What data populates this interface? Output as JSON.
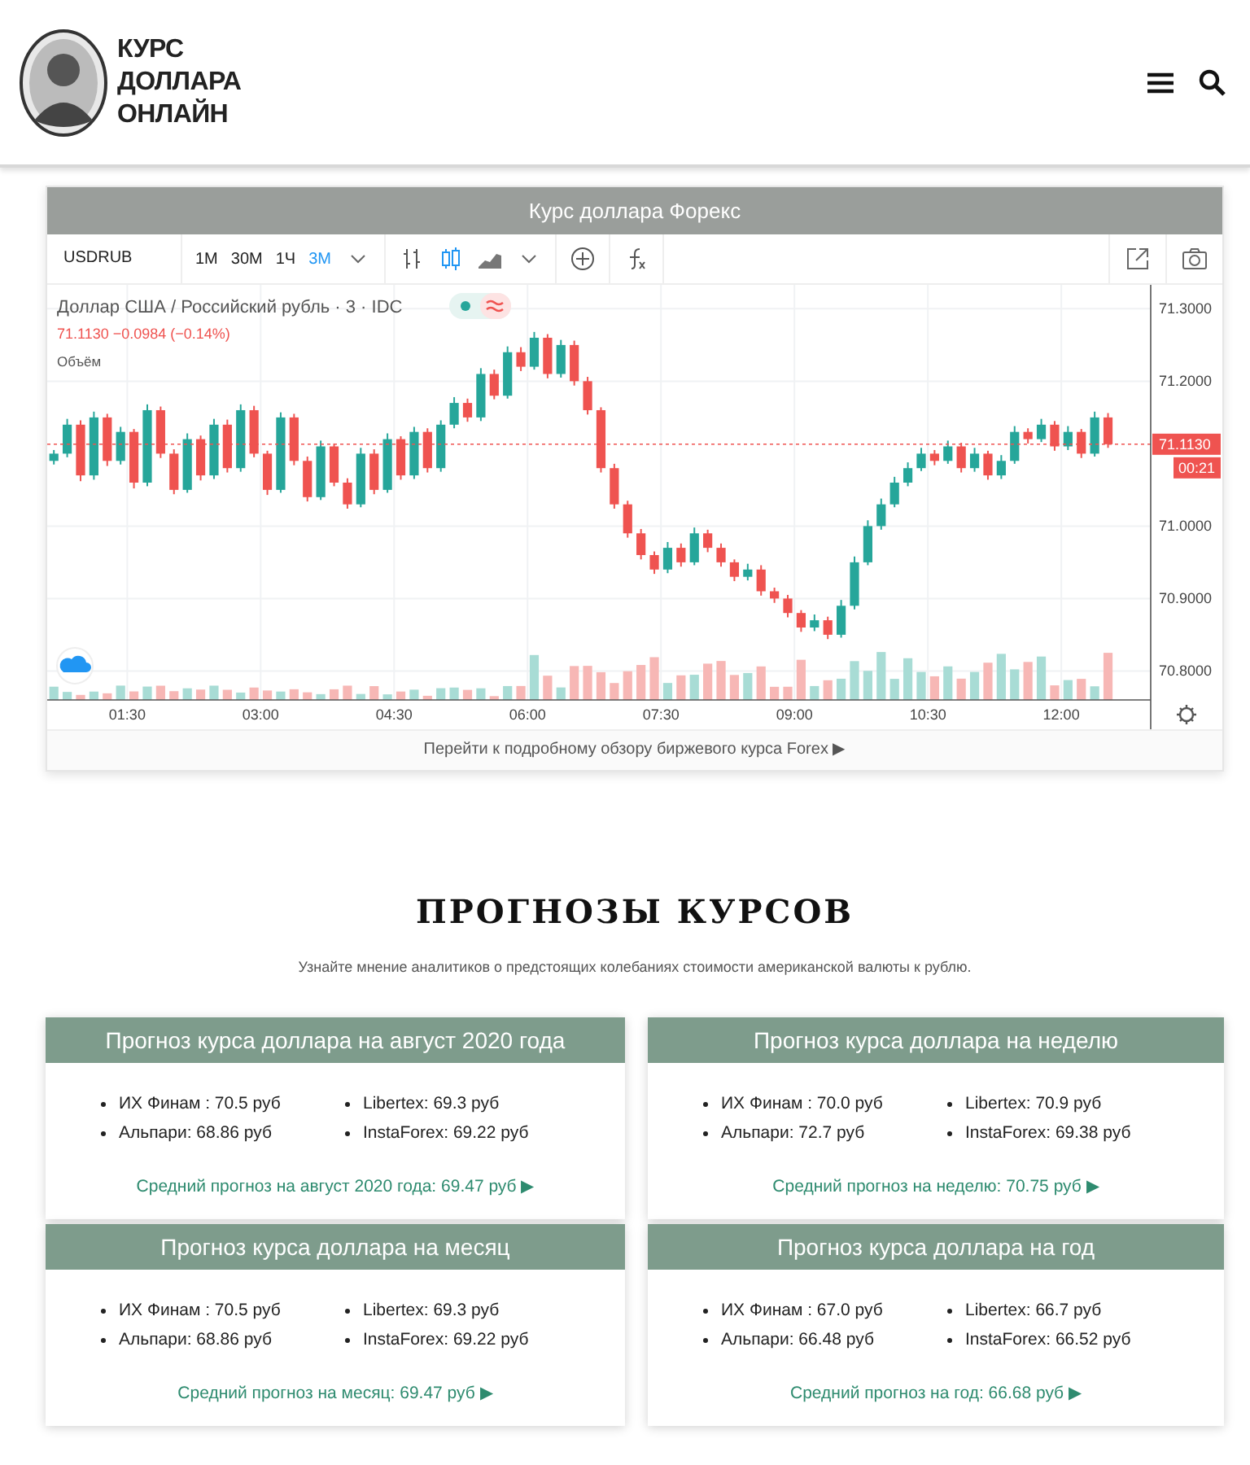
{
  "header": {
    "logo_lines": [
      "КУРС",
      "ДОЛЛАРА",
      "ОНЛАЙН"
    ]
  },
  "forex_widget": {
    "title": "Курс доллара Форекс",
    "symbol": "USDRUB",
    "intervals": [
      {
        "label": "1М",
        "selected": false
      },
      {
        "label": "30М",
        "selected": false
      },
      {
        "label": "1Ч",
        "selected": false
      },
      {
        "label": "3М",
        "selected": true
      }
    ],
    "legend": {
      "title": "Доллар США / Российский рубль · 3 · IDC",
      "quote": "71.1130 −0.0984 (−0.14%)",
      "volume_label": "Объём"
    },
    "last_price": "71.1130",
    "countdown": "00:21",
    "chart_data": {
      "type": "candlestick",
      "grid": true,
      "ref_lines": [
        {
          "axis": "y",
          "value": 71.113,
          "color": "#ef5350"
        }
      ],
      "ylim": [
        70.76,
        71.333
      ],
      "xlim": [
        0.6,
        13.005
      ],
      "x": [
        0.675,
        0.825,
        0.975,
        1.125,
        1.275,
        1.425,
        1.575,
        1.725,
        1.875,
        2.025,
        2.175,
        2.325,
        2.475,
        2.625,
        2.775,
        2.925,
        3.075,
        3.225,
        3.375,
        3.525,
        3.675,
        3.825,
        3.975,
        4.125,
        4.275,
        4.425,
        4.575,
        4.725,
        4.875,
        5.025,
        5.175,
        5.325,
        5.475,
        5.625,
        5.775,
        5.925,
        6.075,
        6.225,
        6.375,
        6.525,
        6.675,
        6.825,
        6.975,
        7.125,
        7.275,
        7.425,
        7.575,
        7.725,
        7.875,
        8.025,
        8.175,
        8.325,
        8.475,
        8.625,
        8.775,
        8.925,
        9.075,
        9.225,
        9.375,
        9.525,
        9.675,
        9.825,
        9.975,
        10.125,
        10.275,
        10.425,
        10.575,
        10.725,
        10.875,
        11.025,
        11.175,
        11.325,
        11.475,
        11.625,
        11.775,
        11.925,
        12.075,
        12.225,
        12.375,
        12.525
      ],
      "ohlc": [
        [
          71.09,
          71.105,
          71.085,
          71.1
        ],
        [
          71.1,
          71.148,
          71.095,
          71.14
        ],
        [
          71.14,
          71.146,
          71.062,
          71.07
        ],
        [
          71.07,
          71.158,
          71.064,
          71.15
        ],
        [
          71.15,
          71.155,
          71.083,
          71.09
        ],
        [
          71.09,
          71.137,
          71.085,
          71.13
        ],
        [
          71.13,
          71.134,
          71.052,
          71.06
        ],
        [
          71.06,
          71.168,
          71.055,
          71.16
        ],
        [
          71.16,
          71.165,
          71.094,
          71.1
        ],
        [
          71.1,
          71.106,
          71.044,
          71.05
        ],
        [
          71.05,
          71.128,
          71.046,
          71.12
        ],
        [
          71.12,
          71.125,
          71.063,
          71.07
        ],
        [
          71.07,
          71.148,
          71.065,
          71.14
        ],
        [
          71.14,
          71.147,
          71.074,
          71.08
        ],
        [
          71.08,
          71.168,
          71.075,
          71.16
        ],
        [
          71.16,
          71.166,
          71.095,
          71.1
        ],
        [
          71.1,
          71.104,
          71.043,
          71.05
        ],
        [
          71.05,
          71.157,
          71.046,
          71.15
        ],
        [
          71.15,
          71.155,
          71.084,
          71.09
        ],
        [
          71.09,
          71.096,
          71.034,
          71.04
        ],
        [
          71.04,
          71.118,
          71.036,
          71.11
        ],
        [
          71.11,
          71.114,
          71.055,
          71.06
        ],
        [
          71.06,
          71.066,
          71.024,
          71.03
        ],
        [
          71.03,
          71.108,
          71.026,
          71.1
        ],
        [
          71.1,
          71.106,
          71.044,
          71.05
        ],
        [
          71.05,
          71.128,
          71.046,
          71.12
        ],
        [
          71.12,
          71.124,
          71.064,
          71.07
        ],
        [
          71.07,
          71.137,
          71.065,
          71.13
        ],
        [
          71.13,
          71.135,
          71.074,
          71.08
        ],
        [
          71.08,
          71.146,
          71.075,
          71.14
        ],
        [
          71.14,
          71.178,
          71.135,
          71.17
        ],
        [
          71.17,
          71.176,
          71.144,
          71.15
        ],
        [
          71.15,
          71.218,
          71.145,
          71.21
        ],
        [
          71.21,
          71.216,
          71.175,
          71.18
        ],
        [
          71.18,
          71.248,
          71.176,
          71.24
        ],
        [
          71.24,
          71.247,
          71.214,
          71.22
        ],
        [
          71.22,
          71.268,
          71.216,
          71.26
        ],
        [
          71.26,
          71.265,
          71.204,
          71.21
        ],
        [
          71.21,
          71.257,
          71.205,
          71.25
        ],
        [
          71.25,
          71.256,
          71.194,
          71.2
        ],
        [
          71.2,
          71.206,
          71.154,
          71.16
        ],
        [
          71.16,
          71.164,
          71.074,
          71.08
        ],
        [
          71.08,
          71.086,
          71.024,
          71.03
        ],
        [
          71.03,
          71.035,
          70.984,
          70.99
        ],
        [
          70.99,
          70.996,
          70.954,
          70.96
        ],
        [
          70.96,
          70.965,
          70.934,
          70.94
        ],
        [
          70.94,
          70.978,
          70.935,
          70.97
        ],
        [
          70.97,
          70.976,
          70.944,
          70.95
        ],
        [
          70.95,
          70.998,
          70.946,
          70.99
        ],
        [
          70.99,
          70.995,
          70.964,
          70.97
        ],
        [
          70.97,
          70.976,
          70.944,
          70.95
        ],
        [
          70.95,
          70.954,
          70.924,
          70.93
        ],
        [
          70.93,
          70.948,
          70.925,
          70.94
        ],
        [
          70.94,
          70.946,
          70.904,
          70.91
        ],
        [
          70.91,
          70.915,
          70.894,
          70.9
        ],
        [
          70.9,
          70.905,
          70.874,
          70.88
        ],
        [
          70.88,
          70.884,
          70.854,
          70.86
        ],
        [
          70.86,
          70.878,
          70.855,
          70.87
        ],
        [
          70.87,
          70.875,
          70.844,
          70.85
        ],
        [
          70.85,
          70.898,
          70.846,
          70.89
        ],
        [
          70.89,
          70.958,
          70.885,
          70.95
        ],
        [
          70.95,
          71.008,
          70.946,
          71.0
        ],
        [
          71.0,
          71.038,
          70.995,
          71.03
        ],
        [
          71.03,
          71.068,
          71.026,
          71.06
        ],
        [
          71.06,
          71.088,
          71.055,
          71.08
        ],
        [
          71.08,
          71.108,
          71.076,
          71.1
        ],
        [
          71.1,
          71.105,
          71.084,
          71.09
        ],
        [
          71.09,
          71.118,
          71.086,
          71.11
        ],
        [
          71.11,
          71.115,
          71.074,
          71.08
        ],
        [
          71.08,
          71.108,
          71.075,
          71.1
        ],
        [
          71.1,
          71.104,
          71.064,
          71.07
        ],
        [
          71.07,
          71.098,
          71.065,
          71.09
        ],
        [
          71.09,
          71.138,
          71.086,
          71.13
        ],
        [
          71.13,
          71.135,
          71.114,
          71.12
        ],
        [
          71.12,
          71.148,
          71.116,
          71.14
        ],
        [
          71.14,
          71.145,
          71.104,
          71.11
        ],
        [
          71.11,
          71.138,
          71.105,
          71.13
        ],
        [
          71.13,
          71.134,
          71.094,
          71.1
        ],
        [
          71.1,
          71.158,
          71.096,
          71.15
        ],
        [
          71.15,
          71.156,
          71.108,
          71.113
        ]
      ],
      "yticks": [
        {
          "value": 71.3,
          "label": "71.3000"
        },
        {
          "value": 71.2,
          "label": "71.2000"
        },
        {
          "value": 71.0,
          "label": "71.0000"
        },
        {
          "value": 70.9,
          "label": "70.9000"
        },
        {
          "value": 70.8,
          "label": "70.8000"
        }
      ],
      "xticks": [
        {
          "value": 1.5,
          "label": "01:30"
        },
        {
          "value": 3,
          "label": "03:00"
        },
        {
          "value": 4.5,
          "label": "04:30"
        },
        {
          "value": 6,
          "label": "06:00"
        },
        {
          "value": 7.5,
          "label": "07:30"
        },
        {
          "value": 9,
          "label": "09:00"
        },
        {
          "value": 10.5,
          "label": "10:30"
        },
        {
          "value": 12,
          "label": "12:00"
        }
      ]
    },
    "link": "Перейти к подробному обзору биржевого курса Forex ▶"
  },
  "forecasts": {
    "title": "ПРОГНОЗЫ КУРСОВ",
    "subtitle": "Узнайте мнение аналитиков о предстоящих колебаниях стоимости американской валюты к рублю.",
    "cards": [
      {
        "title": "Прогноз курса доллара на август 2020 года",
        "items": [
          "ИХ Финам : 70.5 руб",
          "Альпари: 68.86 руб",
          "Libertex: 69.3 руб",
          "InstaForex: 69.22 руб"
        ],
        "average": "Средний прогноз на август 2020 года: 69.47 руб ▶"
      },
      {
        "title": "Прогноз курса доллара на неделю",
        "items": [
          "ИХ Финам : 70.0 руб",
          "Альпари: 72.7 руб",
          "Libertex: 70.9 руб",
          "InstaForex: 69.38 руб"
        ],
        "average": "Средний прогноз на неделю: 70.75 руб ▶"
      },
      {
        "title": "Прогноз курса доллара на месяц",
        "items": [
          "ИХ Финам : 70.5 руб",
          "Альпари: 68.86 руб",
          "Libertex: 69.3 руб",
          "InstaForex: 69.22 руб"
        ],
        "average": "Средний прогноз на месяц: 69.47 руб ▶"
      },
      {
        "title": "Прогноз курса доллара на год",
        "items": [
          "ИХ Финам : 67.0 руб",
          "Альпари: 66.48 руб",
          "Libertex: 66.7 руб",
          "InstaForex: 66.52 руб"
        ],
        "average": "Средний прогноз на год: 66.68 руб ▶"
      }
    ]
  }
}
